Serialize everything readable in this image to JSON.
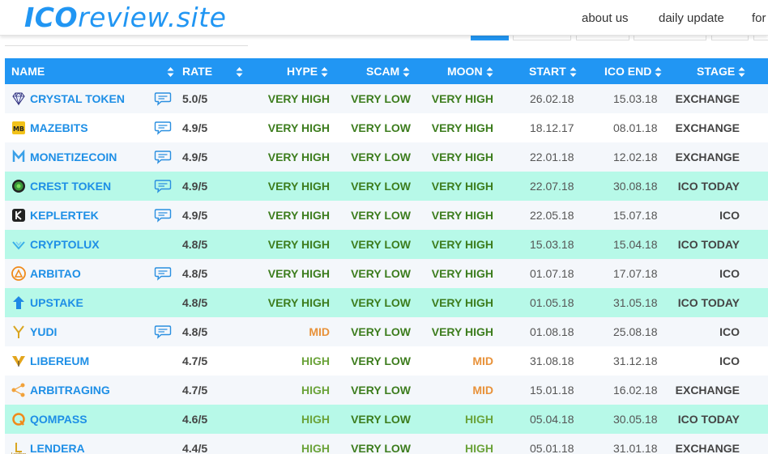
{
  "header": {
    "logo_bold": "ICO",
    "logo_rest": "review.site",
    "nav": [
      {
        "label": "about us"
      },
      {
        "label": "daily update"
      },
      {
        "label": "for"
      }
    ]
  },
  "columns": {
    "name": "NAME",
    "rate": "RATE",
    "hype": "HYPE",
    "scam": "SCAM",
    "moon": "MOON",
    "start": "START",
    "ico_end": "ICO END",
    "stage": "STAGE"
  },
  "rows": [
    {
      "name": "CRYSTAL TOKEN",
      "icon": "diamond-icon",
      "chat": true,
      "rate": "5.0/5",
      "hype": "VERY HIGH",
      "scam": "VERY LOW",
      "moon": "VERY HIGH",
      "start": "26.02.18",
      "end": "15.03.18",
      "stage": "EXCHANGE",
      "highlight": false
    },
    {
      "name": "MAZEBITS",
      "icon": "mazebits-logo-icon",
      "chat": true,
      "rate": "4.9/5",
      "hype": "VERY HIGH",
      "scam": "VERY LOW",
      "moon": "VERY HIGH",
      "start": "18.12.17",
      "end": "08.01.18",
      "stage": "EXCHANGE",
      "highlight": false
    },
    {
      "name": "MONETIZECOIN",
      "icon": "monetizecoin-logo-icon",
      "chat": true,
      "rate": "4.9/5",
      "hype": "VERY HIGH",
      "scam": "VERY LOW",
      "moon": "VERY HIGH",
      "start": "22.01.18",
      "end": "12.02.18",
      "stage": "EXCHANGE",
      "highlight": false
    },
    {
      "name": "CREST TOKEN",
      "icon": "crest-logo-icon",
      "chat": true,
      "rate": "4.9/5",
      "hype": "VERY HIGH",
      "scam": "VERY LOW",
      "moon": "VERY HIGH",
      "start": "22.07.18",
      "end": "30.08.18",
      "stage": "ICO TODAY",
      "highlight": true
    },
    {
      "name": "KEPLERTEK",
      "icon": "keplertek-logo-icon",
      "chat": true,
      "rate": "4.9/5",
      "hype": "VERY HIGH",
      "scam": "VERY LOW",
      "moon": "VERY HIGH",
      "start": "22.05.18",
      "end": "15.07.18",
      "stage": "ICO",
      "highlight": false
    },
    {
      "name": "CRYPTOLUX",
      "icon": "cryptolux-logo-icon",
      "chat": false,
      "rate": "4.8/5",
      "hype": "VERY HIGH",
      "scam": "VERY LOW",
      "moon": "VERY HIGH",
      "start": "15.03.18",
      "end": "15.04.18",
      "stage": "ICO TODAY",
      "highlight": true
    },
    {
      "name": "ARBITAO",
      "icon": "arbitao-logo-icon",
      "chat": true,
      "rate": "4.8/5",
      "hype": "VERY HIGH",
      "scam": "VERY LOW",
      "moon": "VERY HIGH",
      "start": "01.07.18",
      "end": "17.07.18",
      "stage": "ICO",
      "highlight": false
    },
    {
      "name": "UPSTAKE",
      "icon": "upstake-logo-icon",
      "chat": false,
      "rate": "4.8/5",
      "hype": "VERY HIGH",
      "scam": "VERY LOW",
      "moon": "VERY HIGH",
      "start": "01.05.18",
      "end": "31.05.18",
      "stage": "ICO TODAY",
      "highlight": true
    },
    {
      "name": "YUDI",
      "icon": "yudi-logo-icon",
      "chat": true,
      "rate": "4.8/5",
      "hype": "MID",
      "scam": "VERY LOW",
      "moon": "VERY HIGH",
      "start": "01.08.18",
      "end": "25.08.18",
      "stage": "ICO",
      "highlight": false
    },
    {
      "name": "LIBEREUM",
      "icon": "libereum-logo-icon",
      "chat": false,
      "rate": "4.7/5",
      "hype": "HIGH",
      "scam": "VERY LOW",
      "moon": "MID",
      "start": "31.08.18",
      "end": "31.12.18",
      "stage": "ICO",
      "highlight": false
    },
    {
      "name": "ARBITRAGING",
      "icon": "arbitraging-logo-icon",
      "chat": false,
      "rate": "4.7/5",
      "hype": "HIGH",
      "scam": "VERY LOW",
      "moon": "MID",
      "start": "15.01.18",
      "end": "16.02.18",
      "stage": "EXCHANGE",
      "highlight": false
    },
    {
      "name": "QOMPASS",
      "icon": "qompass-logo-icon",
      "chat": false,
      "rate": "4.6/5",
      "hype": "HIGH",
      "scam": "VERY LOW",
      "moon": "HIGH",
      "start": "05.04.18",
      "end": "30.05.18",
      "stage": "ICO TODAY",
      "highlight": true
    },
    {
      "name": "LENDERA",
      "icon": "lendera-logo-icon",
      "chat": false,
      "rate": "4.4/5",
      "hype": "HIGH",
      "scam": "VERY LOW",
      "moon": "HIGH",
      "start": "05.01.18",
      "end": "31.01.18",
      "stage": "EXCHANGE",
      "highlight": false
    }
  ],
  "colors": {
    "accent": "#2196f3",
    "highlight_row": "#b7f9e8",
    "very_high": "#3d7d1e",
    "high": "#6ba33a",
    "mid": "#e8923a"
  }
}
